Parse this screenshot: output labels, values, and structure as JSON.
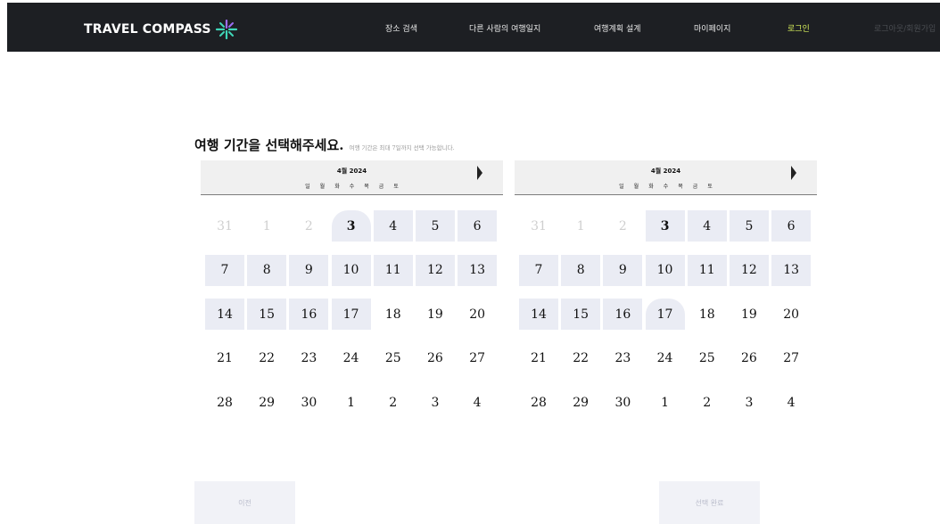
{
  "header": {
    "logo_text": "TRAVEL COMPASS",
    "logo_icon": "compass-star-icon",
    "nav": [
      "장소 검색",
      "다른 사람의 여행일지",
      "여행계획 설계",
      "마이페이지",
      "로그인",
      "로그아웃/회원가입"
    ],
    "login_color": "#d6ee5a"
  },
  "title": {
    "main": "여행 기간을 선택해주세요.",
    "sub": "여행 기간은 최대 7일까지 선택 가능합니다."
  },
  "calendars": [
    {
      "month": "4월 2024",
      "weekdays": [
        "일",
        "월",
        "화",
        "수",
        "목",
        "금",
        "토"
      ],
      "weeks": [
        [
          "31",
          "1",
          "2",
          "3",
          "4",
          "5",
          "6"
        ],
        [
          "7",
          "8",
          "9",
          "10",
          "11",
          "12",
          "13"
        ],
        [
          "14",
          "15",
          "16",
          "17",
          "18",
          "19",
          "20"
        ],
        [
          "21",
          "22",
          "23",
          "24",
          "25",
          "26",
          "27"
        ],
        [
          "28",
          "29",
          "30",
          "1",
          "2",
          "3",
          "4"
        ]
      ]
    },
    {
      "month": "4월 2024",
      "weekdays": [
        "일",
        "월",
        "화",
        "수",
        "목",
        "금",
        "토"
      ],
      "weeks": [
        [
          "31",
          "1",
          "2",
          "3",
          "4",
          "5",
          "6"
        ],
        [
          "7",
          "8",
          "9",
          "10",
          "11",
          "12",
          "13"
        ],
        [
          "14",
          "15",
          "16",
          "17",
          "18",
          "19",
          "20"
        ],
        [
          "21",
          "22",
          "23",
          "24",
          "25",
          "26",
          "27"
        ],
        [
          "28",
          "29",
          "30",
          "1",
          "2",
          "3",
          "4"
        ]
      ]
    }
  ],
  "buttons": {
    "prev": "이전",
    "done": "선택 완료"
  },
  "colors": {
    "header_bg": "#1d1f23",
    "selected_day_bg": "#eaecf4",
    "button_bg": "#f1f2f7"
  }
}
